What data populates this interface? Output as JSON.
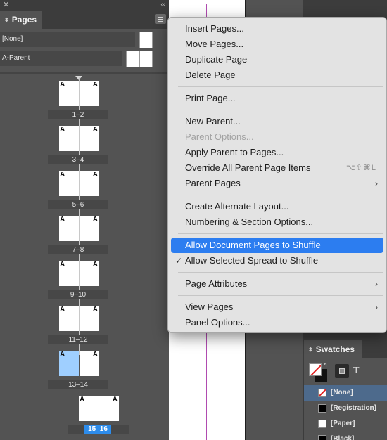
{
  "pages_panel": {
    "tab_label": "Pages",
    "parents": [
      {
        "label": "[None]"
      },
      {
        "label": "A-Parent"
      }
    ],
    "page_marker": "A",
    "spreads": [
      {
        "label": "1–2"
      },
      {
        "label": "3–4"
      },
      {
        "label": "5–6"
      },
      {
        "label": "7–8"
      },
      {
        "label": "9–10"
      },
      {
        "label": "11–12"
      },
      {
        "label": "13–14"
      },
      {
        "label": "15–16"
      }
    ]
  },
  "context_menu": {
    "items": [
      {
        "label": "Insert Pages..."
      },
      {
        "label": "Move Pages..."
      },
      {
        "label": "Duplicate Page"
      },
      {
        "label": "Delete Page"
      },
      {
        "label": "Print Page..."
      },
      {
        "label": "New Parent..."
      },
      {
        "label": "Parent Options..."
      },
      {
        "label": "Apply Parent to Pages..."
      },
      {
        "label": "Override All Parent Page Items",
        "shortcut": "⌥⇧⌘L"
      },
      {
        "label": "Parent Pages"
      },
      {
        "label": "Create Alternate Layout..."
      },
      {
        "label": "Numbering & Section Options..."
      },
      {
        "label": "Allow Document Pages to Shuffle"
      },
      {
        "label": "Allow Selected Spread to Shuffle",
        "check": "✓"
      },
      {
        "label": "Page Attributes"
      },
      {
        "label": "View Pages"
      },
      {
        "label": "Panel Options..."
      }
    ]
  },
  "swatches_panel": {
    "tab_label": "Swatches",
    "text_mode": "T",
    "items": [
      {
        "name": "[None]"
      },
      {
        "name": "[Registration]"
      },
      {
        "name": "[Paper]"
      },
      {
        "name": "[Black]"
      }
    ]
  },
  "colors": {
    "panel_bg": "#535353",
    "menu_bg": "#e3e3e3",
    "highlight": "#2c7df0",
    "selected_page": "#9fcfff",
    "selected_label": "#2d8ceb"
  }
}
